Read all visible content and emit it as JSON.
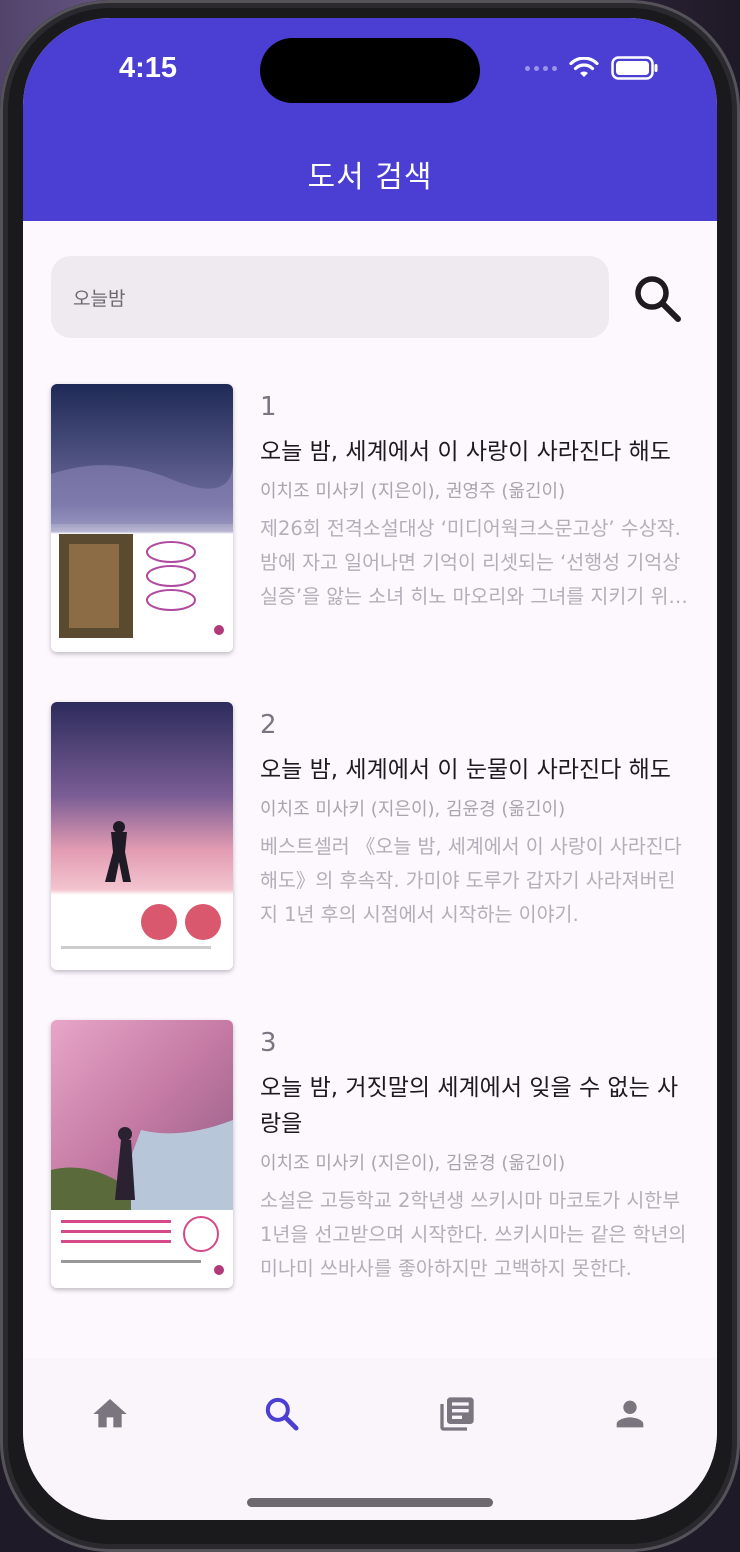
{
  "status_bar": {
    "time": "4:15"
  },
  "app_bar": {
    "title": "도서 검색",
    "color": "#4a3ed3"
  },
  "search": {
    "value": "오늘밤",
    "icon": "search-icon"
  },
  "books": [
    {
      "rank": "1",
      "title": "오늘 밤, 세계에서 이 사랑이 사라진다 해도",
      "author": "이치조 미사키 (지은이), 권영주 (옮긴이)",
      "description": "제26회 전격소설대상 ‘미디어웍크스문고상’ 수상작. 밤에 자고 일어나면 기억이 리셋되는 ‘선행성 기억상실증’을 앓는 소녀 히노 마오리와 그녀를 지키기 위해 가짜 연인이 된 소년 가미야 도루의 이야기."
    },
    {
      "rank": "2",
      "title": "오늘 밤, 세계에서 이 눈물이 사라진다 해도",
      "author": "이치조 미사키 (지은이), 김윤경 (옮긴이)",
      "description": "베스트셀러 《오늘 밤, 세계에서 이 사랑이 사라진다 해도》의 후속작. 가미야 도루가 갑자기 사라져버린 지 1년 후의 시점에서 시작하는 이야기."
    },
    {
      "rank": "3",
      "title": "오늘 밤, 거짓말의 세계에서 잊을 수 없는 사랑을",
      "author": "이치조 미사키 (지은이), 김윤경 (옮긴이)",
      "description": "소설은 고등학교 2학년생 쓰키시마 마코토가 시한부 1년을 선고받으며 시작한다. 쓰키시마는 같은 학년의 미나미 쓰바사를 좋아하지만 고백하지 못한다."
    }
  ],
  "bottom_nav": {
    "items": [
      {
        "icon": "home-icon",
        "active": false
      },
      {
        "icon": "search-icon",
        "active": true
      },
      {
        "icon": "library-icon",
        "active": false
      },
      {
        "icon": "person-icon",
        "active": false
      }
    ],
    "active_color": "#4a3ed3",
    "inactive_color": "#7a757f"
  }
}
